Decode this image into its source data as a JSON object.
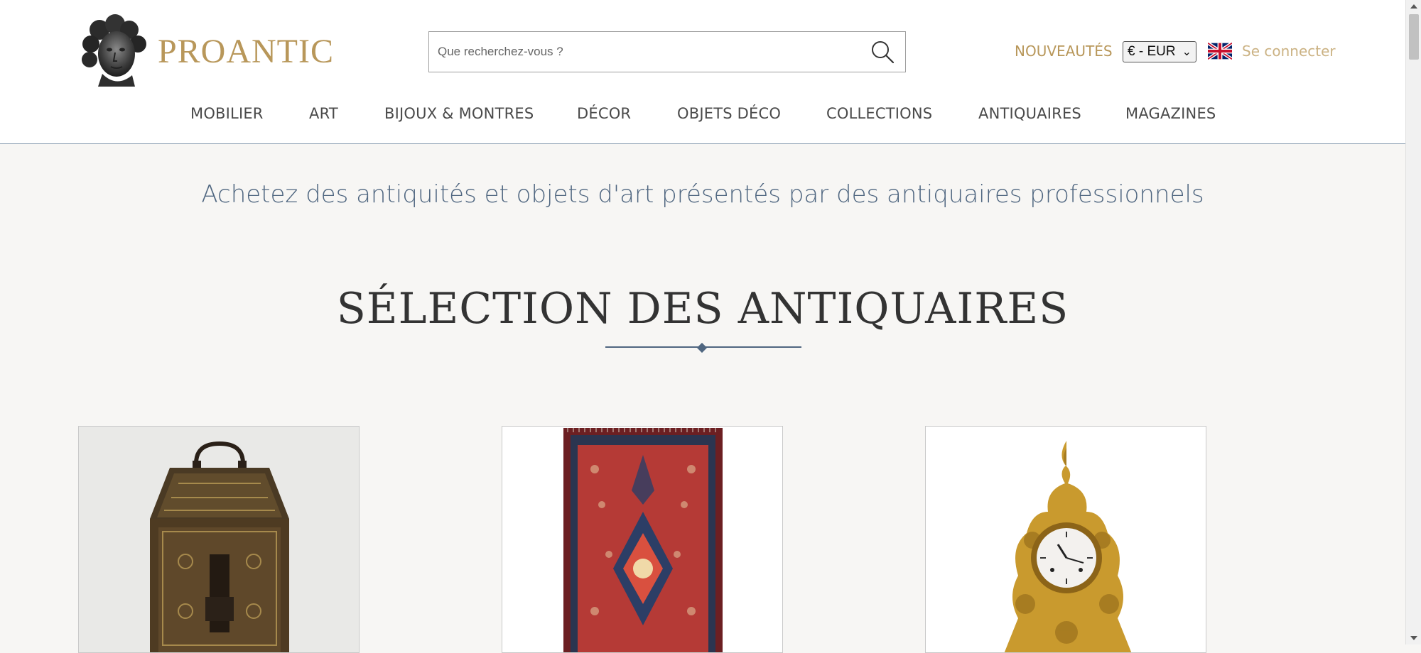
{
  "brand": {
    "name": "PROANTIC",
    "logo_icon": "bust-logo-icon",
    "color": "#b8975a"
  },
  "search": {
    "placeholder": "Que recherchez-vous ?",
    "value": "",
    "icon": "search-icon"
  },
  "header_links": {
    "new": "NOUVEAUTÉS",
    "currency": "€ - EUR",
    "language_flag": "uk-flag-icon",
    "login": "Se connecter"
  },
  "nav": {
    "items": [
      {
        "label": "MOBILIER"
      },
      {
        "label": "ART"
      },
      {
        "label": "BIJOUX & MONTRES"
      },
      {
        "label": "DÉCOR"
      },
      {
        "label": "OBJETS DÉCO"
      },
      {
        "label": "COLLECTIONS"
      },
      {
        "label": "ANTIQUAIRES"
      },
      {
        "label": "MAGAZINES"
      }
    ]
  },
  "main": {
    "tagline": "Achetez des antiquités et objets d'art présentés par des antiquaires professionnels",
    "section_title": "SÉLECTION DES ANTIQUAIRES",
    "cards": [
      {
        "image": "antique-casket-image"
      },
      {
        "image": "persian-rug-image"
      },
      {
        "image": "gilt-bronze-clock-image"
      }
    ]
  },
  "colors": {
    "accent_gold": "#b8975a",
    "accent_blue": "#4f6680",
    "background": "#f7f6f4"
  }
}
